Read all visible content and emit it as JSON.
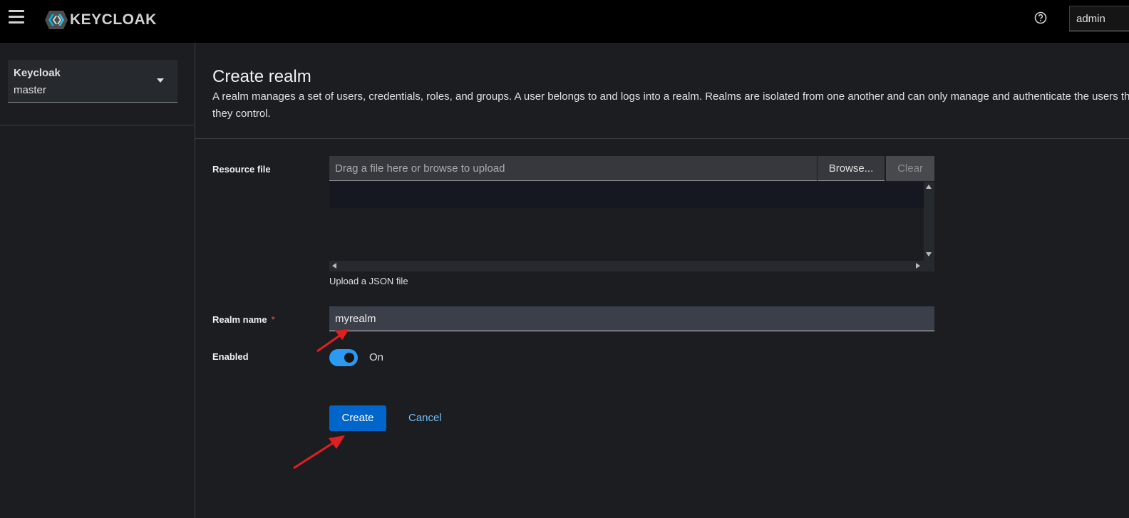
{
  "header": {
    "logo_text": "KEYCLOAK",
    "user_label": "admin"
  },
  "sidebar": {
    "realm_selector": {
      "title": "Keycloak",
      "value": "master"
    }
  },
  "page": {
    "title": "Create realm",
    "description": "A realm manages a set of users, credentials, roles, and groups. A user belongs to and logs into a realm. Realms are isolated from one another and can only manage and authenticate the users that they control."
  },
  "form": {
    "resource_file": {
      "label": "Resource file",
      "placeholder": "Drag a file here or browse to upload",
      "browse_label": "Browse...",
      "clear_label": "Clear",
      "helper": "Upload a JSON file"
    },
    "realm_name": {
      "label": "Realm name",
      "required_mark": "*",
      "value": "myrealm"
    },
    "enabled": {
      "label": "Enabled",
      "state_label": "On",
      "checked": true
    },
    "create_label": "Create",
    "cancel_label": "Cancel"
  },
  "colors": {
    "primary": "#0066cc",
    "toggle_on": "#2b9af3",
    "link": "#73bcf7",
    "required": "#ee5a52",
    "annotation_arrow": "#e02020"
  },
  "icons": [
    "hamburger-icon",
    "keycloak-logo-icon",
    "help-icon",
    "caret-down-icon"
  ]
}
